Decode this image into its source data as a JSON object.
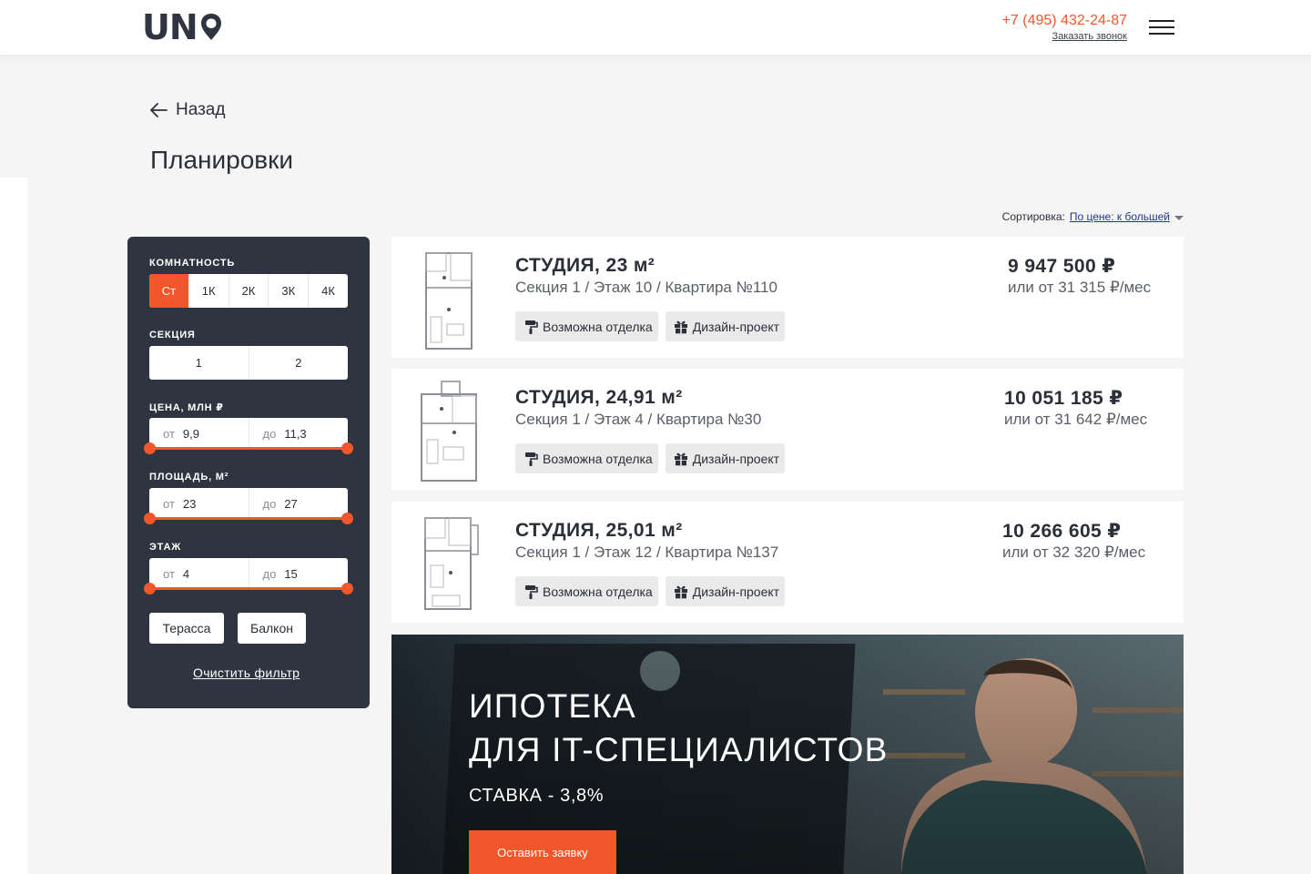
{
  "header": {
    "logo_text": "UN",
    "phone": "+7 (495) 432-24-87",
    "callback": "Заказать звонок"
  },
  "nav": {
    "back_label": "Назад",
    "page_title": "Планировки"
  },
  "sort": {
    "label": "Сортировка:",
    "value": "По цене: к большей"
  },
  "filter": {
    "rooms": {
      "label": "Комнатность",
      "options": [
        "Ст",
        "1К",
        "2К",
        "3К",
        "4К"
      ],
      "selected": "Ст"
    },
    "section": {
      "label": "Секция",
      "options": [
        "1",
        "2"
      ]
    },
    "price": {
      "label": "Цена, млн ₽",
      "from_prefix": "от",
      "from": "9,9",
      "to_prefix": "до",
      "to": "11,3"
    },
    "area": {
      "label": "Площадь, м²",
      "from_prefix": "от",
      "from": "23",
      "to_prefix": "до",
      "to": "27"
    },
    "floor": {
      "label": "Этаж",
      "from_prefix": "от",
      "from": "4",
      "to_prefix": "до",
      "to": "15"
    },
    "toggles": [
      "Терасса",
      "Балкон"
    ],
    "clear_label": "Очистить фильтр"
  },
  "apartments": [
    {
      "title": "СТУДИЯ, 23 м²",
      "details": "Секция 1 / Этаж 10 / Квартира №110",
      "tag_finish": "Возможна отделка",
      "tag_design": "Дизайн-проект",
      "price": "9 947 500 ₽",
      "monthly": "или от 31 315 ₽/мес"
    },
    {
      "title": "СТУДИЯ, 24,91 м²",
      "details": "Секция 1 / Этаж 4 / Квартира №30",
      "tag_finish": "Возможна отделка",
      "tag_design": "Дизайн-проект",
      "price": "10 051 185 ₽",
      "monthly": "или от 31 642 ₽/мес"
    },
    {
      "title": "СТУДИЯ, 25,01 м²",
      "details": "Секция 1 / Этаж 12 / Квартира №137",
      "tag_finish": "Возможна отделка",
      "tag_design": "Дизайн-проект",
      "price": "10 266 605 ₽",
      "monthly": "или от 32 320 ₽/мес"
    }
  ],
  "banner": {
    "title_line1": "ИПОТЕКА",
    "title_line2": "ДЛЯ IT-СПЕЦИАЛИСТОВ",
    "rate": "СТАВКА - 3,8%",
    "button": "Оставить заявку"
  },
  "colors": {
    "accent": "#f2572b",
    "panel": "#2f3441",
    "background": "#f5f5f5"
  }
}
